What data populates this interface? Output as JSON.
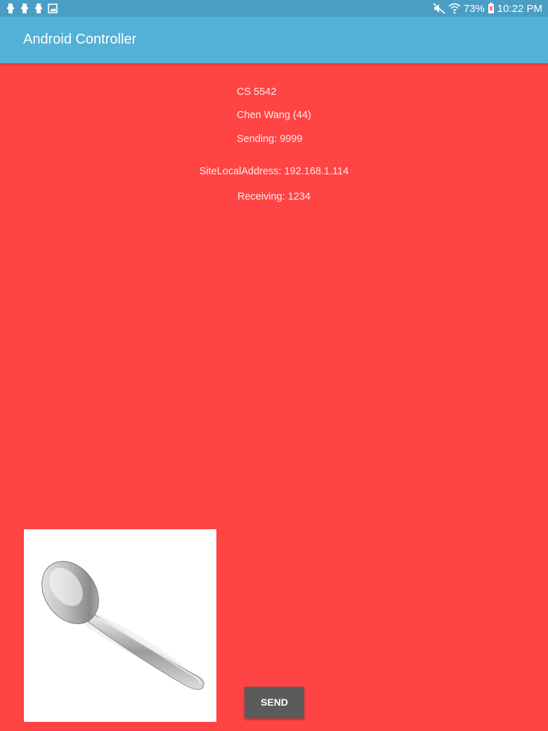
{
  "status_bar": {
    "battery": "73%",
    "time": "10:22 PM",
    "notification_icons": [
      "android-debug-icon",
      "android-debug-icon",
      "android-debug-icon",
      "gallery-icon"
    ],
    "system_icons": [
      "mute-icon",
      "wifi-icon",
      "battery-icon"
    ]
  },
  "app_bar": {
    "title": "Android Controller",
    "color": "#53b0d6"
  },
  "info": {
    "course": "CS 5542",
    "author": "Chen Wang (44)",
    "sending": "Sending: 9999",
    "site_local_address": "SiteLocalAddress: 192.168.1.114",
    "receiving": "Receiving: 1234"
  },
  "image": {
    "subject": "spoon"
  },
  "send_button": {
    "label": "SEND"
  },
  "colors": {
    "background": "#ff4444",
    "status_bar": "#4a9ec4",
    "button": "#5b5b5b"
  }
}
